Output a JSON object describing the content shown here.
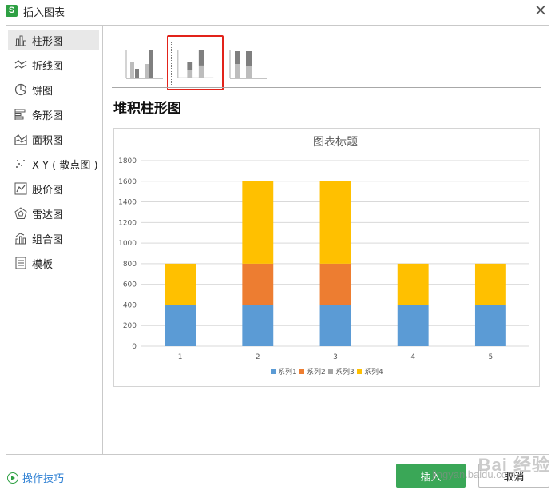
{
  "window": {
    "title": "插入图表",
    "app_icon_letter": "S"
  },
  "sidebar": {
    "items": [
      {
        "label": "柱形图",
        "icon": "column-chart-icon",
        "active": true
      },
      {
        "label": "折线图",
        "icon": "line-chart-icon"
      },
      {
        "label": "饼图",
        "icon": "pie-chart-icon"
      },
      {
        "label": "条形图",
        "icon": "bar-chart-icon"
      },
      {
        "label": "面积图",
        "icon": "area-chart-icon"
      },
      {
        "label": "X Y ( 散点图 )",
        "icon": "scatter-chart-icon"
      },
      {
        "label": "股价图",
        "icon": "stock-chart-icon"
      },
      {
        "label": "雷达图",
        "icon": "radar-chart-icon"
      },
      {
        "label": "组合图",
        "icon": "combo-chart-icon"
      },
      {
        "label": "模板",
        "icon": "template-icon"
      }
    ]
  },
  "subtypes": {
    "selected_index": 1,
    "selected_title": "堆积柱形图"
  },
  "colors": {
    "series1": "#5b9bd5",
    "series2": "#ed7d31",
    "series3": "#a5a5a5",
    "series4": "#ffc000",
    "accent_green": "#3aa757",
    "highlight_red": "#e2231a",
    "link_blue": "#2d7fd3"
  },
  "chart_data": {
    "type": "bar",
    "stacked": true,
    "title": "图表标题",
    "categories": [
      "1",
      "2",
      "3",
      "4",
      "5"
    ],
    "series": [
      {
        "name": "系列1",
        "values": [
          400,
          400,
          400,
          400,
          400
        ]
      },
      {
        "name": "系列2",
        "values": [
          0,
          400,
          400,
          0,
          0
        ]
      },
      {
        "name": "系列3",
        "values": [
          0,
          0,
          0,
          0,
          0
        ]
      },
      {
        "name": "系列4",
        "values": [
          400,
          800,
          800,
          400,
          400
        ]
      }
    ],
    "ylim": [
      0,
      1800
    ],
    "yticks": [
      "0",
      "200",
      "400",
      "600",
      "800",
      "1000",
      "1200",
      "1400",
      "1600",
      "1800"
    ],
    "grid": true,
    "legend_position": "bottom"
  },
  "footer": {
    "tips_label": "操作技巧",
    "insert_label": "插入",
    "cancel_label": "取消"
  },
  "watermark": {
    "text": "Bai 经验",
    "sub": "jingyan.baidu.com"
  }
}
